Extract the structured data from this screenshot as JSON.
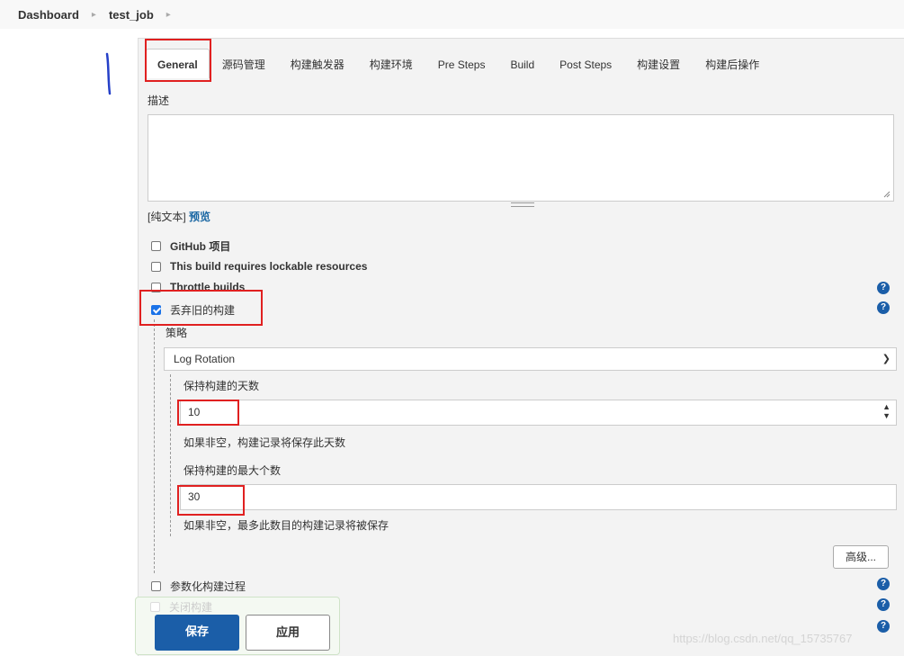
{
  "breadcrumb": {
    "items": [
      "Dashboard",
      "test_job"
    ],
    "separator_icon": "chevron-right-icon"
  },
  "tabs": [
    "General",
    "源码管理",
    "构建触发器",
    "构建环境",
    "Pre Steps",
    "Build",
    "Post Steps",
    "构建设置",
    "构建后操作"
  ],
  "description": {
    "label": "描述",
    "value": "",
    "plain_text": "[纯文本]",
    "preview": "预览"
  },
  "options": {
    "github": "GitHub 项目",
    "lockable": "This build requires lockable resources",
    "throttle": "Throttle builds",
    "discard": "丢弃旧的构建",
    "parameterized": "参数化构建过程",
    "disable": "关闭构建"
  },
  "discard_checked": true,
  "strategy": {
    "label": "策略",
    "selected": "Log Rotation"
  },
  "days": {
    "label": "保持构建的天数",
    "value": "10",
    "help": "如果非空，构建记录将保存此天数"
  },
  "max": {
    "label": "保持构建的最大个数",
    "value": "30",
    "help": "如果非空，最多此数目的构建记录将被保存"
  },
  "advanced_button": "高级...",
  "save_button": "保存",
  "apply_button": "应用",
  "help_icon_glyph": "?",
  "watermark": "https://blog.csdn.net/qq_15735767",
  "colors": {
    "primary": "#1b5ea8",
    "checkbox": "#1b73e8",
    "highlight": "#e02020",
    "link": "#1a67a3"
  }
}
